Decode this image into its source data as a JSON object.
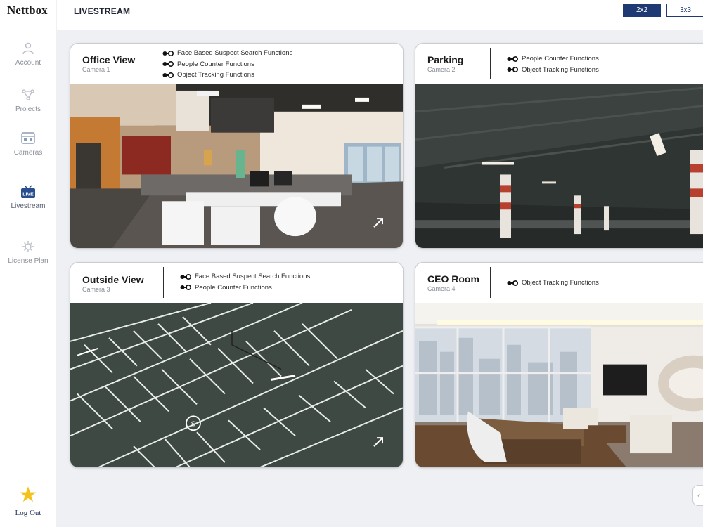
{
  "app": {
    "brand": "Nettbox"
  },
  "header": {
    "title": "LIVESTREAM",
    "layout_options": [
      "2x2",
      "3x3"
    ],
    "selected_layout": "2x2"
  },
  "sidebar": {
    "items": [
      {
        "label": "Account",
        "icon": "user-icon"
      },
      {
        "label": "Projects",
        "icon": "projects-icon"
      },
      {
        "label": "Cameras",
        "icon": "camera-icon"
      },
      {
        "label": "Livestream",
        "icon": "live-icon",
        "badge": "LIVE",
        "active": true
      },
      {
        "label": "License Plan",
        "icon": "gear-icon"
      }
    ],
    "logout": {
      "label": "Log Out",
      "icon": "star-icon"
    }
  },
  "cameras": [
    {
      "name": "Office View",
      "camera": "Camera 1",
      "features": [
        "Face Based Suspect Search Functions",
        "People Counter Functions",
        "Object Tracking Functions"
      ]
    },
    {
      "name": "Parking",
      "camera": "Camera 2",
      "features": [
        "People Counter Functions",
        "Object Tracking Functions"
      ]
    },
    {
      "name": "Outside View",
      "camera": "Camera 3",
      "features": [
        "Face Based Suspect Search Functions",
        "People Counter Functions"
      ]
    },
    {
      "name": "CEO Room",
      "camera": "Camera 4",
      "features": [
        "Object Tracking Functions"
      ]
    }
  ],
  "colors": {
    "primary": "#1f3a72",
    "accent_star": "#f4c21b",
    "background": "#eef0f3"
  }
}
